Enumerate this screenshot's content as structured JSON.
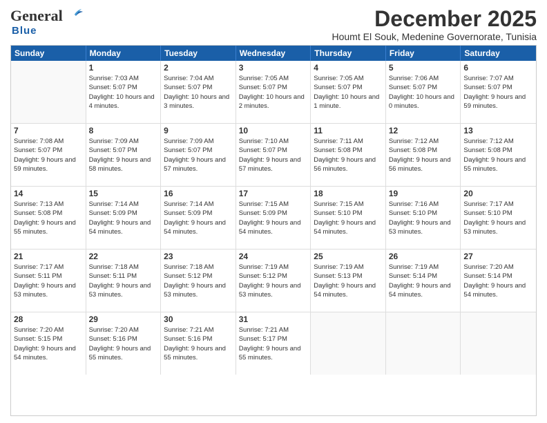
{
  "logo": {
    "general": "General",
    "blue": "Blue"
  },
  "title": "December 2025",
  "location": "Houmt El Souk, Medenine Governorate, Tunisia",
  "days_of_week": [
    "Sunday",
    "Monday",
    "Tuesday",
    "Wednesday",
    "Thursday",
    "Friday",
    "Saturday"
  ],
  "weeks": [
    [
      {
        "day": "",
        "sunrise": "",
        "sunset": "",
        "daylight": ""
      },
      {
        "day": "1",
        "sunrise": "Sunrise: 7:03 AM",
        "sunset": "Sunset: 5:07 PM",
        "daylight": "Daylight: 10 hours and 4 minutes."
      },
      {
        "day": "2",
        "sunrise": "Sunrise: 7:04 AM",
        "sunset": "Sunset: 5:07 PM",
        "daylight": "Daylight: 10 hours and 3 minutes."
      },
      {
        "day": "3",
        "sunrise": "Sunrise: 7:05 AM",
        "sunset": "Sunset: 5:07 PM",
        "daylight": "Daylight: 10 hours and 2 minutes."
      },
      {
        "day": "4",
        "sunrise": "Sunrise: 7:05 AM",
        "sunset": "Sunset: 5:07 PM",
        "daylight": "Daylight: 10 hours and 1 minute."
      },
      {
        "day": "5",
        "sunrise": "Sunrise: 7:06 AM",
        "sunset": "Sunset: 5:07 PM",
        "daylight": "Daylight: 10 hours and 0 minutes."
      },
      {
        "day": "6",
        "sunrise": "Sunrise: 7:07 AM",
        "sunset": "Sunset: 5:07 PM",
        "daylight": "Daylight: 9 hours and 59 minutes."
      }
    ],
    [
      {
        "day": "7",
        "sunrise": "Sunrise: 7:08 AM",
        "sunset": "Sunset: 5:07 PM",
        "daylight": "Daylight: 9 hours and 59 minutes."
      },
      {
        "day": "8",
        "sunrise": "Sunrise: 7:09 AM",
        "sunset": "Sunset: 5:07 PM",
        "daylight": "Daylight: 9 hours and 58 minutes."
      },
      {
        "day": "9",
        "sunrise": "Sunrise: 7:09 AM",
        "sunset": "Sunset: 5:07 PM",
        "daylight": "Daylight: 9 hours and 57 minutes."
      },
      {
        "day": "10",
        "sunrise": "Sunrise: 7:10 AM",
        "sunset": "Sunset: 5:07 PM",
        "daylight": "Daylight: 9 hours and 57 minutes."
      },
      {
        "day": "11",
        "sunrise": "Sunrise: 7:11 AM",
        "sunset": "Sunset: 5:08 PM",
        "daylight": "Daylight: 9 hours and 56 minutes."
      },
      {
        "day": "12",
        "sunrise": "Sunrise: 7:12 AM",
        "sunset": "Sunset: 5:08 PM",
        "daylight": "Daylight: 9 hours and 56 minutes."
      },
      {
        "day": "13",
        "sunrise": "Sunrise: 7:12 AM",
        "sunset": "Sunset: 5:08 PM",
        "daylight": "Daylight: 9 hours and 55 minutes."
      }
    ],
    [
      {
        "day": "14",
        "sunrise": "Sunrise: 7:13 AM",
        "sunset": "Sunset: 5:08 PM",
        "daylight": "Daylight: 9 hours and 55 minutes."
      },
      {
        "day": "15",
        "sunrise": "Sunrise: 7:14 AM",
        "sunset": "Sunset: 5:09 PM",
        "daylight": "Daylight: 9 hours and 54 minutes."
      },
      {
        "day": "16",
        "sunrise": "Sunrise: 7:14 AM",
        "sunset": "Sunset: 5:09 PM",
        "daylight": "Daylight: 9 hours and 54 minutes."
      },
      {
        "day": "17",
        "sunrise": "Sunrise: 7:15 AM",
        "sunset": "Sunset: 5:09 PM",
        "daylight": "Daylight: 9 hours and 54 minutes."
      },
      {
        "day": "18",
        "sunrise": "Sunrise: 7:15 AM",
        "sunset": "Sunset: 5:10 PM",
        "daylight": "Daylight: 9 hours and 54 minutes."
      },
      {
        "day": "19",
        "sunrise": "Sunrise: 7:16 AM",
        "sunset": "Sunset: 5:10 PM",
        "daylight": "Daylight: 9 hours and 53 minutes."
      },
      {
        "day": "20",
        "sunrise": "Sunrise: 7:17 AM",
        "sunset": "Sunset: 5:10 PM",
        "daylight": "Daylight: 9 hours and 53 minutes."
      }
    ],
    [
      {
        "day": "21",
        "sunrise": "Sunrise: 7:17 AM",
        "sunset": "Sunset: 5:11 PM",
        "daylight": "Daylight: 9 hours and 53 minutes."
      },
      {
        "day": "22",
        "sunrise": "Sunrise: 7:18 AM",
        "sunset": "Sunset: 5:11 PM",
        "daylight": "Daylight: 9 hours and 53 minutes."
      },
      {
        "day": "23",
        "sunrise": "Sunrise: 7:18 AM",
        "sunset": "Sunset: 5:12 PM",
        "daylight": "Daylight: 9 hours and 53 minutes."
      },
      {
        "day": "24",
        "sunrise": "Sunrise: 7:19 AM",
        "sunset": "Sunset: 5:12 PM",
        "daylight": "Daylight: 9 hours and 53 minutes."
      },
      {
        "day": "25",
        "sunrise": "Sunrise: 7:19 AM",
        "sunset": "Sunset: 5:13 PM",
        "daylight": "Daylight: 9 hours and 54 minutes."
      },
      {
        "day": "26",
        "sunrise": "Sunrise: 7:19 AM",
        "sunset": "Sunset: 5:14 PM",
        "daylight": "Daylight: 9 hours and 54 minutes."
      },
      {
        "day": "27",
        "sunrise": "Sunrise: 7:20 AM",
        "sunset": "Sunset: 5:14 PM",
        "daylight": "Daylight: 9 hours and 54 minutes."
      }
    ],
    [
      {
        "day": "28",
        "sunrise": "Sunrise: 7:20 AM",
        "sunset": "Sunset: 5:15 PM",
        "daylight": "Daylight: 9 hours and 54 minutes."
      },
      {
        "day": "29",
        "sunrise": "Sunrise: 7:20 AM",
        "sunset": "Sunset: 5:16 PM",
        "daylight": "Daylight: 9 hours and 55 minutes."
      },
      {
        "day": "30",
        "sunrise": "Sunrise: 7:21 AM",
        "sunset": "Sunset: 5:16 PM",
        "daylight": "Daylight: 9 hours and 55 minutes."
      },
      {
        "day": "31",
        "sunrise": "Sunrise: 7:21 AM",
        "sunset": "Sunset: 5:17 PM",
        "daylight": "Daylight: 9 hours and 55 minutes."
      },
      {
        "day": "",
        "sunrise": "",
        "sunset": "",
        "daylight": ""
      },
      {
        "day": "",
        "sunrise": "",
        "sunset": "",
        "daylight": ""
      },
      {
        "day": "",
        "sunrise": "",
        "sunset": "",
        "daylight": ""
      }
    ]
  ]
}
